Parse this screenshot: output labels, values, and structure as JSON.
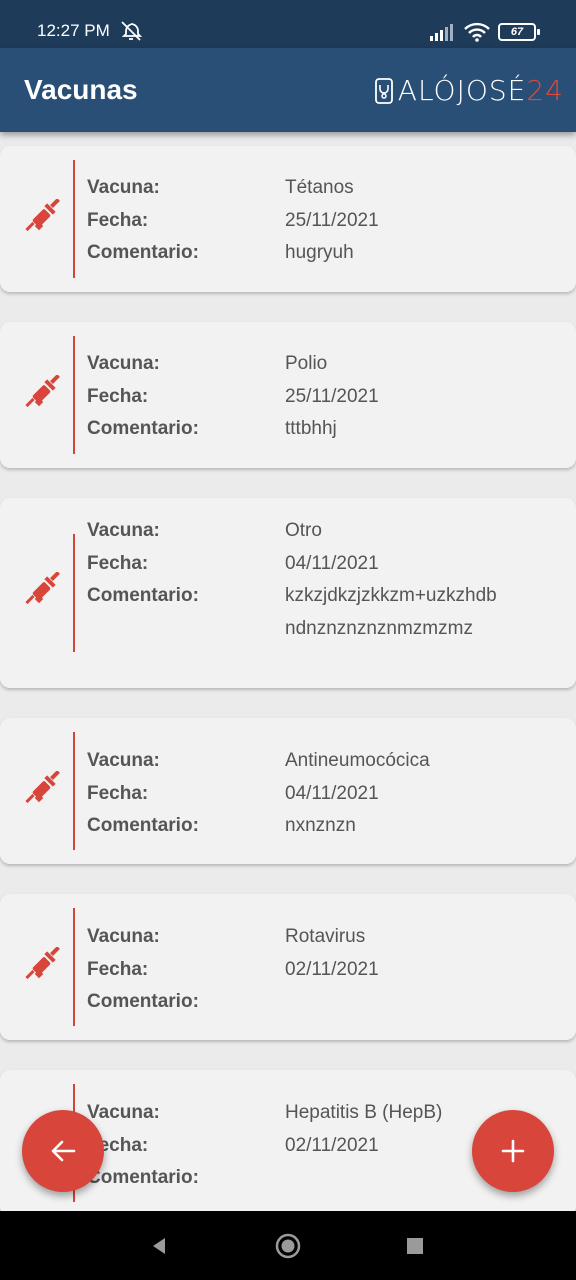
{
  "status_bar": {
    "time": "12:27 PM",
    "battery": "67"
  },
  "app_bar": {
    "title": "Vacunas",
    "brand_text": "ALÓJOSÉ",
    "brand_number": "24"
  },
  "labels": {
    "vacuna": "Vacuna:",
    "fecha": "Fecha:",
    "comentario": "Comentario:"
  },
  "records": [
    {
      "vacuna": "Tétanos",
      "fecha": "25/11/2021",
      "comentario": "hugryuh"
    },
    {
      "vacuna": "Polio",
      "fecha": "25/11/2021",
      "comentario": "tttbhhj"
    },
    {
      "vacuna": "Otro",
      "fecha": "04/11/2021",
      "comentario": "kzkzjdkzjzkkzm+uzkzhdbndnznznznznmzmzmz"
    },
    {
      "vacuna": "Antineumocócica",
      "fecha": "04/11/2021",
      "comentario": "nxnznzn"
    },
    {
      "vacuna": "Rotavirus",
      "fecha": "02/11/2021",
      "comentario": ""
    },
    {
      "vacuna": "Hepatitis B (HepB)",
      "fecha": "02/11/2021",
      "comentario": ""
    }
  ],
  "icons": {
    "vaccine": "syringe-icon",
    "back": "arrow-left-icon",
    "add": "plus-icon"
  },
  "colors": {
    "status_bar": "#1f3b5a",
    "app_bar": "#2a4f76",
    "accent": "#d8453a",
    "card": "#f2f2f2",
    "background": "#ebebeb"
  }
}
